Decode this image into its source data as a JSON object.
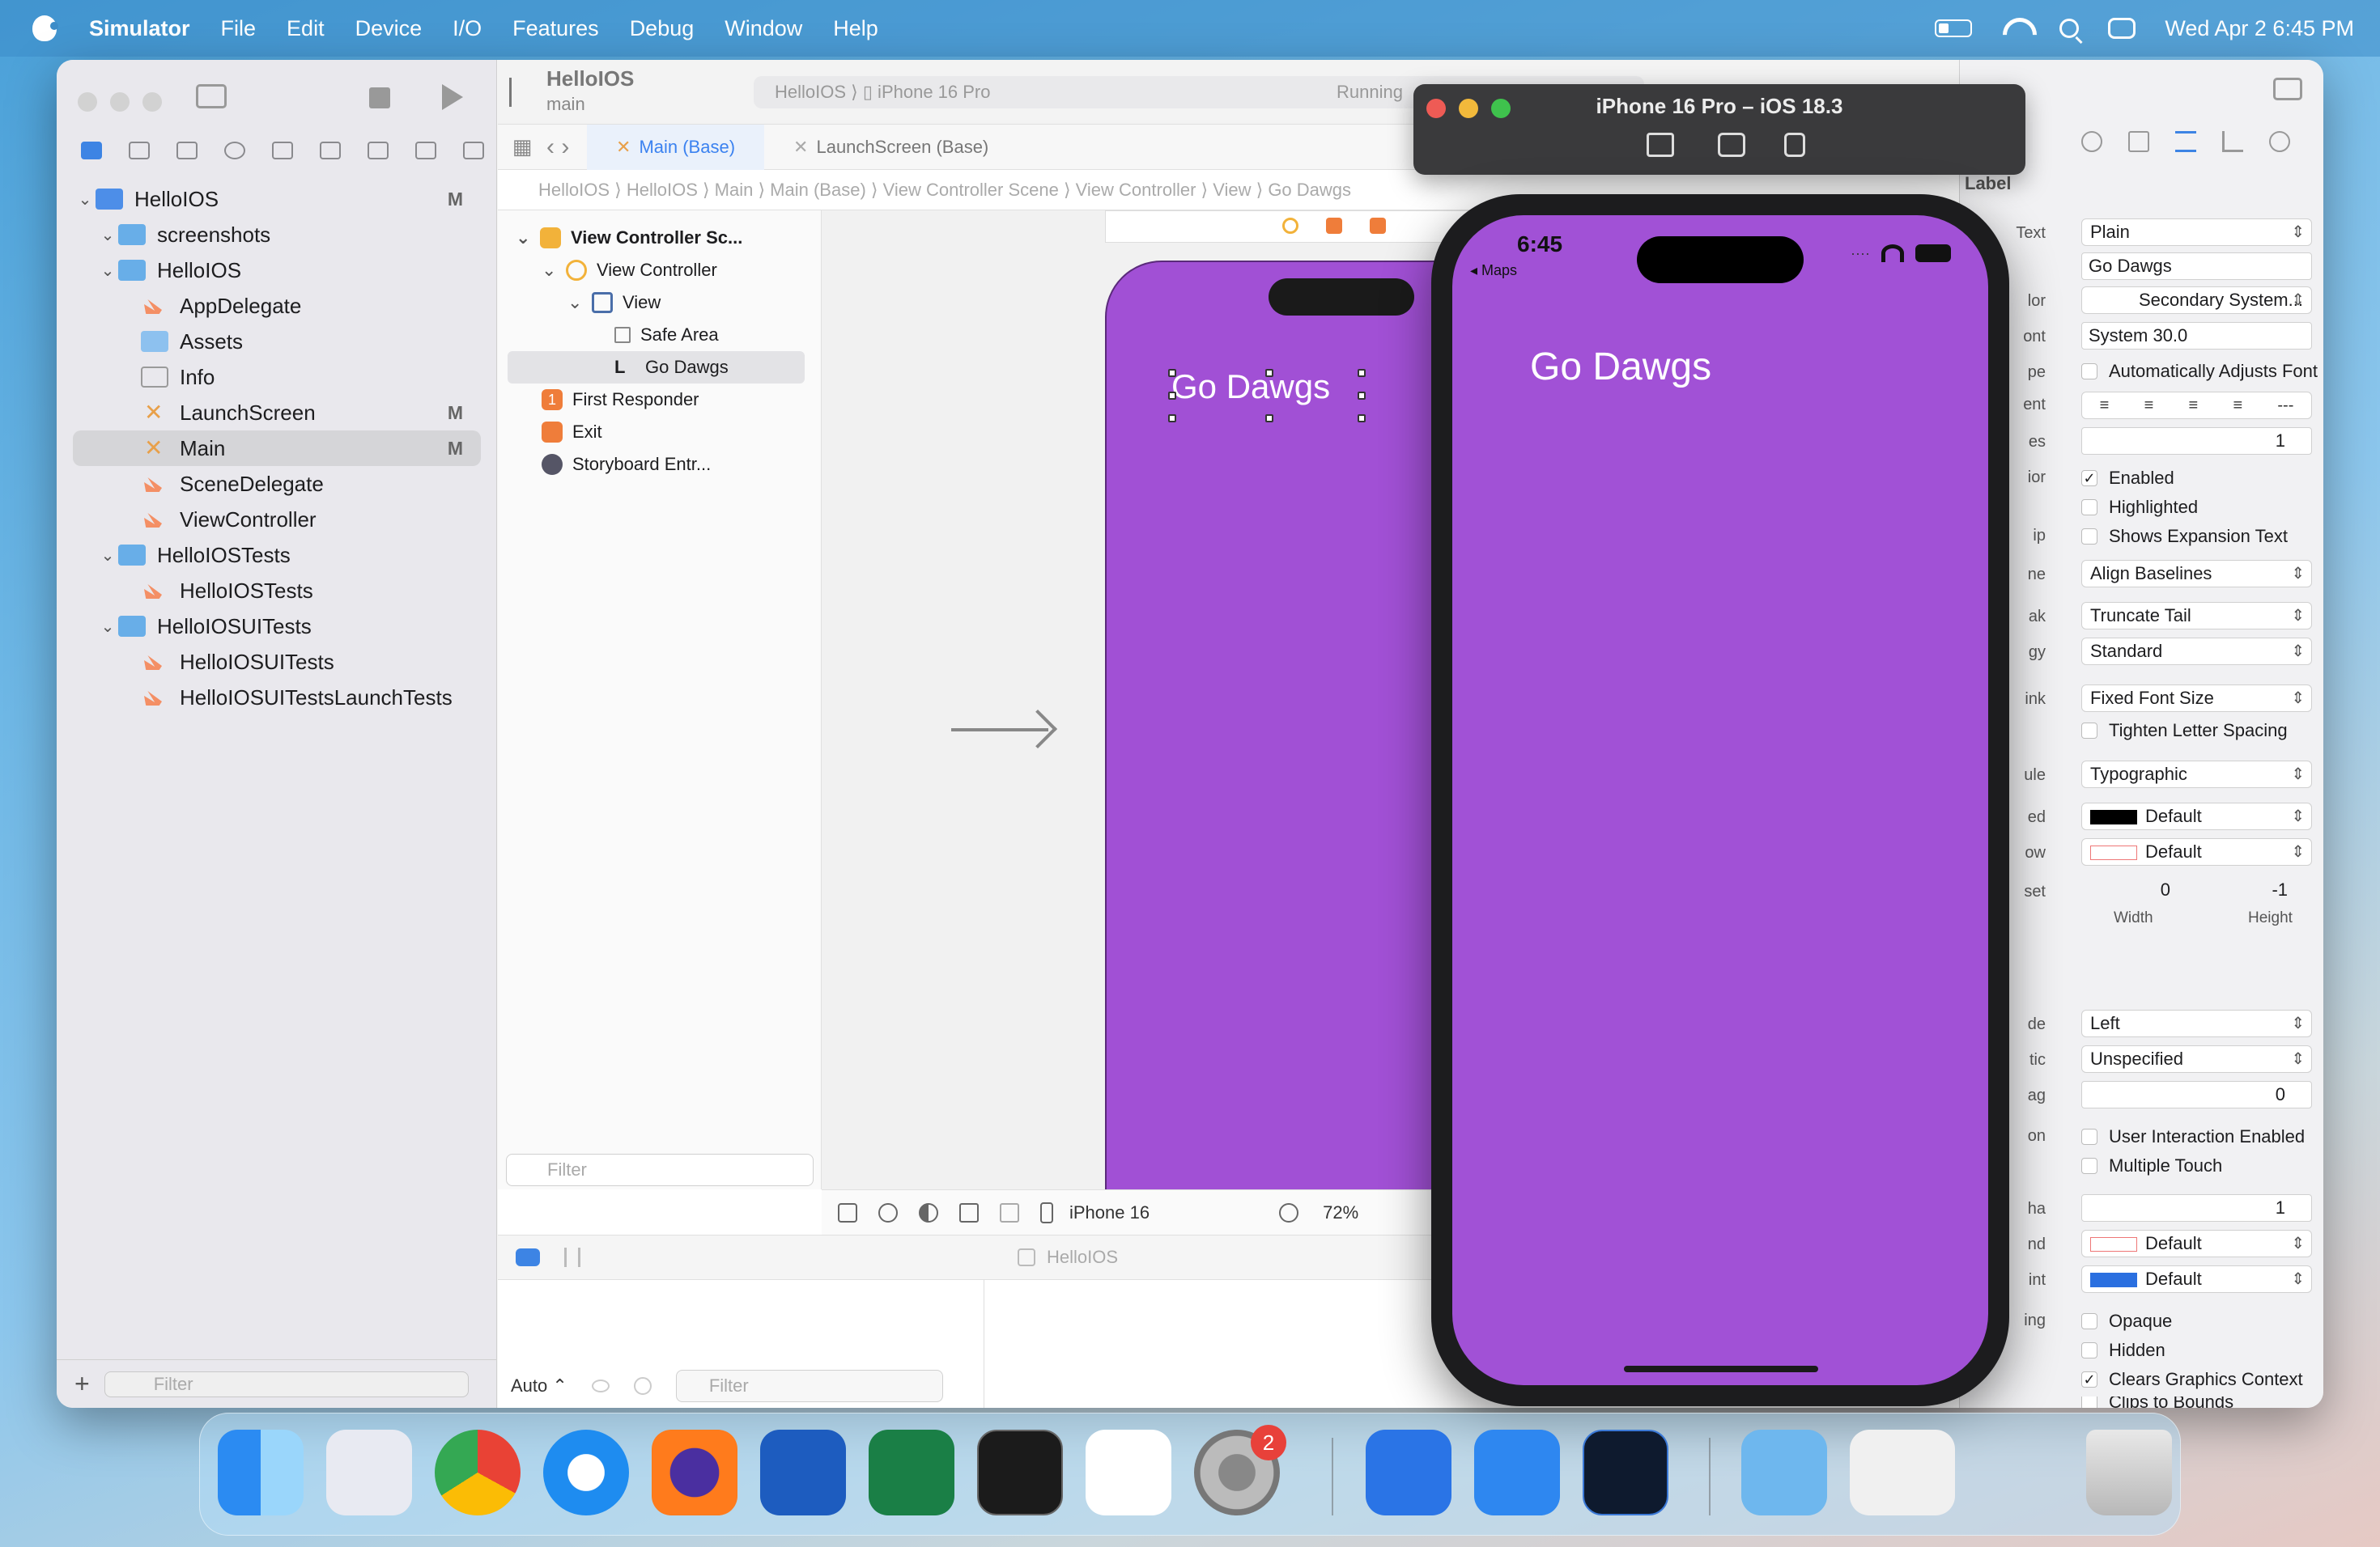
{
  "menubar": {
    "app_name": "Simulator",
    "items": [
      "File",
      "Edit",
      "Device",
      "I/O",
      "Features",
      "Debug",
      "Window",
      "Help"
    ],
    "datetime": "Wed Apr 2  6:45 PM"
  },
  "xcode": {
    "toolbar": {
      "scheme": "HelloIOS",
      "branch": "main",
      "destination": "HelloIOS  ⟩  ▯  iPhone 16 Pro",
      "status": "Running"
    },
    "navigator": {
      "items": [
        {
          "label": "HelloIOS",
          "badge": "M"
        },
        {
          "label": "screenshots",
          "badge": ""
        },
        {
          "label": "HelloIOS",
          "badge": ""
        },
        {
          "label": "AppDelegate",
          "badge": ""
        },
        {
          "label": "Assets",
          "badge": ""
        },
        {
          "label": "Info",
          "badge": ""
        },
        {
          "label": "LaunchScreen",
          "badge": "M"
        },
        {
          "label": "Main",
          "badge": "M"
        },
        {
          "label": "SceneDelegate",
          "badge": ""
        },
        {
          "label": "ViewController",
          "badge": ""
        },
        {
          "label": "HelloIOSTests",
          "badge": ""
        },
        {
          "label": "HelloIOSTests",
          "badge": ""
        },
        {
          "label": "HelloIOSUITests",
          "badge": ""
        },
        {
          "label": "HelloIOSUITests",
          "badge": ""
        },
        {
          "label": "HelloIOSUITestsLaunchTests",
          "badge": ""
        }
      ],
      "filter_placeholder": "Filter"
    },
    "tabs": [
      "Main (Base)",
      "LaunchScreen (Base)"
    ],
    "jumpbar": "HelloIOS  ⟩   HelloIOS  ⟩   Main  ⟩   Main (Base)  ⟩   View Controller Scene  ⟩   View Controller  ⟩   View  ⟩   Go Dawgs",
    "outline": [
      {
        "label": "View Controller Sc..."
      },
      {
        "label": "View Controller"
      },
      {
        "label": "View"
      },
      {
        "label": "Safe Area"
      },
      {
        "label": "Go Dawgs"
      },
      {
        "label": "First Responder"
      },
      {
        "label": "Exit"
      },
      {
        "label": "Storyboard Entr..."
      }
    ],
    "outline_filter": "Filter",
    "canvas_label": "Go Dawgs",
    "device_name": "iPhone 16",
    "zoom": "72%",
    "debug_target": "HelloIOS",
    "console_mode": "Auto ⌃",
    "console_filter": "Filter",
    "inspector": {
      "header": "Label",
      "text_type": "Plain",
      "text_value": "Go Dawgs",
      "color": "Secondary System...",
      "font": "System 30.0",
      "auto_adjust": "Automatically Adjusts Font",
      "lines": "1",
      "enabled": "Enabled",
      "highlighted": "Highlighted",
      "expansion": "Shows Expansion Text",
      "baseline": "Align Baselines",
      "line_break": "Truncate Tail",
      "strategy": "Standard",
      "autoshrink": "Fixed Font Size",
      "tighten": "Tighten Letter Spacing",
      "capitalization": "Typographic",
      "highlighted_color": "Default",
      "shadow": "Default",
      "shadow_width": "0",
      "shadow_height": "-1",
      "width_label": "Width",
      "height_label": "Height",
      "content_mode": "Left",
      "semantic": "Unspecified",
      "tag": "0",
      "user_interaction": "User Interaction Enabled",
      "multiple_touch": "Multiple Touch",
      "alpha": "1",
      "background": "Default",
      "tint": "Default",
      "opaque": "Opaque",
      "hidden": "Hidden",
      "clears": "Clears Graphics Context",
      "clip": "Clips to Bounds",
      "labels": [
        "Text",
        "lor",
        "ont",
        "pe",
        "ent",
        "es",
        "ior",
        "ip",
        "ne",
        "ak",
        "gy",
        "ink",
        "ule",
        "ed",
        "ow",
        "set",
        "de",
        "tic",
        "ag",
        "on",
        "ha",
        "nd",
        "int",
        "ing"
      ]
    }
  },
  "simulator": {
    "title": "iPhone 16 Pro – iOS 18.3",
    "time": "6:45",
    "back_app": "◂ Maps",
    "label": "Go Dawgs",
    "screen_color": "#a151d6"
  },
  "dock": {
    "notification_count": "2",
    "apps": [
      "Finder",
      "Launchpad",
      "Chrome",
      "Safari",
      "Firefox",
      "Word",
      "Excel",
      "Terminal",
      "Slack",
      "System Settings",
      "Xcode",
      "Simulator",
      "Instruments",
      "Downloads",
      "Screenshots",
      "Trash"
    ]
  }
}
